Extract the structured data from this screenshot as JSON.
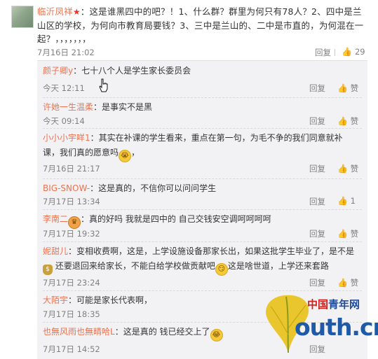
{
  "main_comment": {
    "user": "临沂凤祥",
    "text": "：这是谁黑四中的吧？！1、什么群？群里为何只有78人？2、四中是兰山区的学校，为何向市教育局要钱？3、三中是兰山的、二中是市直的，为何混在一起？，，，，，，，",
    "time": "7月16日 21:02",
    "reply_label": "回复",
    "like_count": "29",
    "verified_icon": "star-icon"
  },
  "replies": [
    {
      "user": "颜子卿y",
      "badge": "",
      "text": "：七十八个人是学生家长委员会",
      "time": "今天 12:11",
      "reply_label": "回复",
      "like_label": "赞"
    },
    {
      "user": "许她一生温柔",
      "badge": "",
      "text": "：是事实不是黑",
      "time": "今天 09:14",
      "reply_label": "回复",
      "like_label": "赞"
    },
    {
      "user": "小小小宇咩1",
      "badge": "",
      "text": "：其实在补课的学生看来，重点在第一句，为毛不争的我们同意就补课，我们真的愿意吗",
      "time": "7月16日 21:17",
      "reply_label": "回复",
      "like_label": "赞"
    },
    {
      "user": "BIG-SNOW-",
      "badge": "",
      "text": "：这是真的，不信你可以问问学生",
      "time": "7月17日 13:34",
      "reply_label": "回复",
      "like_label": "1"
    },
    {
      "user": "李南二",
      "badge": "",
      "text": "：真的好吗  我就是四中的  自己交钱安空调呵呵呵呵",
      "time": "7月17日 19:32",
      "reply_label": "回复",
      "like_label": "赞"
    },
    {
      "user": "妮甜儿",
      "badge": "",
      "text_a": "：变相收费啊，这是，上学设施设备那家长出，如果这批学生毕业了，是不是",
      "text_b": "还要退回来给家长，不能白给学校做贡献吧",
      "text_c": "这是啥世道，上学还来套路",
      "time": "7月17日 23:24",
      "reply_label": "回复",
      "like_label": "赞"
    },
    {
      "user": "大陌宇",
      "badge": "",
      "text": "：可能是家长代表啊，",
      "time": "7月17日 18:35",
      "reply_label": "",
      "like_label": ""
    },
    {
      "user": "也無风雨也無晴哈L",
      "badge": "",
      "text": "：这是真的 钱已经交上了",
      "time": "7月17日 14:52",
      "reply_label": "回复",
      "like_label": ""
    }
  ],
  "watermark": {
    "brand_red": "中国",
    "brand_blue": "青年网",
    "domain": "outh.cn"
  },
  "colors": {
    "username": "#eb7350",
    "meta": "#808080",
    "reply_bg": "#f2f2f5",
    "brand_blue": "#1e5aa8",
    "brand_red": "#d0201a"
  }
}
